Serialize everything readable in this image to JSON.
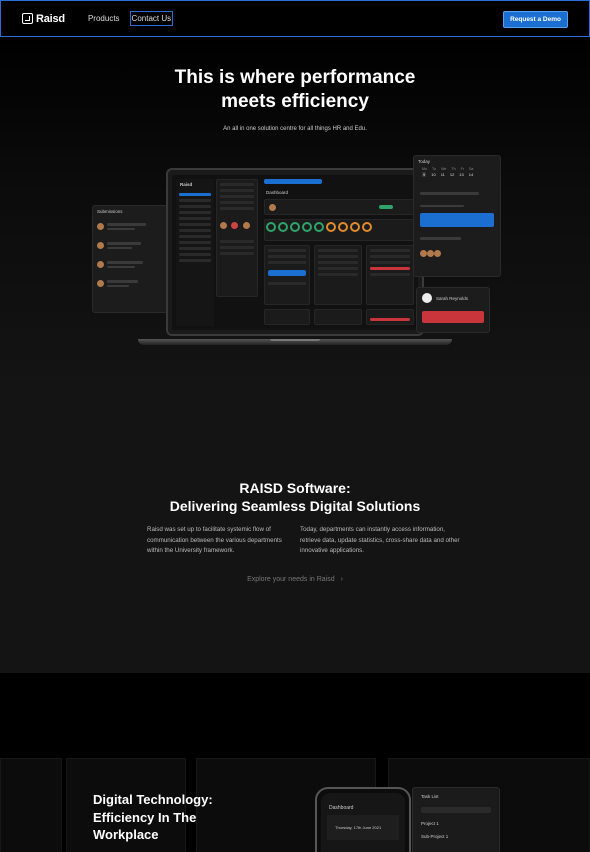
{
  "nav": {
    "brand": "Raisd",
    "links": [
      "Products",
      "Contact Us"
    ],
    "cta": "Request a Demo"
  },
  "hero": {
    "title_line1": "This is where performance",
    "title_line2": "meets efficiency",
    "subtitle": "An all in one solution centre for all things HR and Edu.",
    "mock": {
      "submissions_title": "Submissions",
      "today_title": "Today",
      "dashboard_title": "Dashboard",
      "brand": "Raisd",
      "days": [
        "Su",
        "Mo",
        "Tu",
        "We",
        "Th",
        "Fr",
        "Sa"
      ],
      "dates": [
        "9",
        "10",
        "11",
        "12",
        "13",
        "14"
      ],
      "profile_name": "Sarah Reynolds"
    }
  },
  "software": {
    "title_line1": "RAISD Software:",
    "title_line2": "Delivering Seamless Digital Solutions",
    "col1": "Raisd was set up to facilitate systemic flow of communication between the various departments within the University framework.",
    "col2": "Today, departments can instantly access information, retrieve data, update statistics, cross-share data and other innovative applications.",
    "explore": "Explore your needs in Raisd"
  },
  "digital": {
    "title": "Digital Technology: Efficiency In The Workplace",
    "phone_dashboard": "Dashboard",
    "phone_date": "Thursday, 17th June 2021",
    "task_title": "Task List",
    "task_items": [
      "Project 1",
      "Sub-Project 1"
    ]
  },
  "colors": {
    "accent": "#1a6fd0",
    "nav_border": "#2b6fd6",
    "danger": "#c9353a",
    "success": "#2fa36b"
  }
}
